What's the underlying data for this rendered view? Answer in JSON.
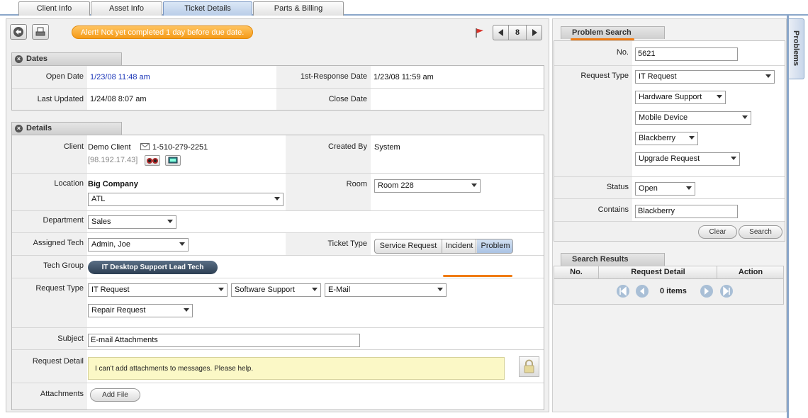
{
  "tabs": [
    {
      "label": "Client Info"
    },
    {
      "label": "Asset Info"
    },
    {
      "label": "Ticket Details"
    },
    {
      "label": "Parts & Billing"
    }
  ],
  "side_tab": "Problems",
  "toolbar": {
    "alert": "Alert! Not yet completed 1 day before due date.",
    "page_number": "8"
  },
  "dates": {
    "title": "Dates",
    "open_date_label": "Open Date",
    "open_date": "1/23/08 11:48 am",
    "first_response_label": "1st-Response Date",
    "first_response": "1/23/08 11:59 am",
    "last_updated_label": "Last Updated",
    "last_updated": "1/24/08 8:07 am",
    "close_date_label": "Close Date",
    "close_date": ""
  },
  "details": {
    "title": "Details",
    "client_label": "Client",
    "client": "Demo Client",
    "phone": "1-510-279-2251",
    "ip": "[98.192.17.43]",
    "created_by_label": "Created By",
    "created_by": "System",
    "location_label": "Location",
    "location": "Big Company",
    "location_select": "ATL",
    "room_label": "Room",
    "room": "Room 228",
    "department_label": "Department",
    "department": "Sales",
    "assigned_tech_label": "Assigned Tech",
    "assigned_tech": "Admin, Joe",
    "ticket_type_label": "Ticket Type",
    "ticket_types": [
      "Service Request",
      "Incident",
      "Problem"
    ],
    "tech_group_label": "Tech Group",
    "tech_group": "IT Desktop Support  Lead Tech",
    "request_type_label": "Request Type",
    "request_type_1": "IT Request",
    "request_type_2": "Software Support",
    "request_type_3": "E-Mail",
    "request_type_4": "Repair Request",
    "subject_label": "Subject",
    "subject": "E-mail Attachments",
    "request_detail_label": "Request Detail",
    "request_detail": "I can't add attachments to messages. Please help.",
    "attachments_label": "Attachments",
    "add_file": "Add File"
  },
  "problem_search": {
    "title": "Problem Search",
    "no_label": "No.",
    "no": "5621",
    "request_type_label": "Request Type",
    "request_types": [
      "IT Request",
      "Hardware Support",
      "Mobile Device",
      "Blackberry",
      "Upgrade Request"
    ],
    "status_label": "Status",
    "status": "Open",
    "contains_label": "Contains",
    "contains": "Blackberry",
    "clear": "Clear",
    "search": "Search"
  },
  "search_results": {
    "title": "Search Results",
    "columns": [
      "No.",
      "Request Detail",
      "Action"
    ],
    "count": "0 items"
  }
}
